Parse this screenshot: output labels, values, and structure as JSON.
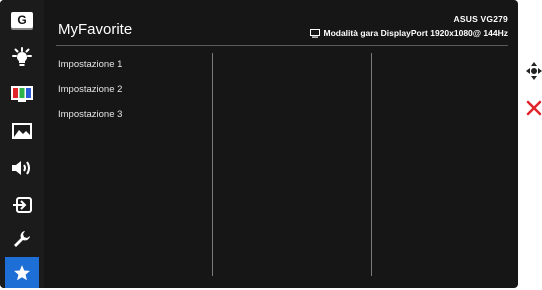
{
  "osd": {
    "title": "MyFavorite",
    "model": "ASUS VG279",
    "mode_info": "Modalità gara DisplayPort 1920x1080@ 144Hz"
  },
  "sidebar": {
    "items": [
      {
        "icon": "gameplus-icon",
        "label": "G"
      },
      {
        "icon": "bluelight-icon"
      },
      {
        "icon": "color-icon"
      },
      {
        "icon": "image-icon"
      },
      {
        "icon": "sound-icon"
      },
      {
        "icon": "input-icon"
      },
      {
        "icon": "system-setup-icon"
      },
      {
        "icon": "myfavorite-star-icon",
        "active": true
      }
    ]
  },
  "menu": {
    "items": [
      "Impostazione 1",
      "Impostazione 2",
      "Impostazione 3"
    ]
  },
  "colors": {
    "panel": "#161616",
    "accent": "#1d6fd6",
    "close": "#e0252b"
  }
}
